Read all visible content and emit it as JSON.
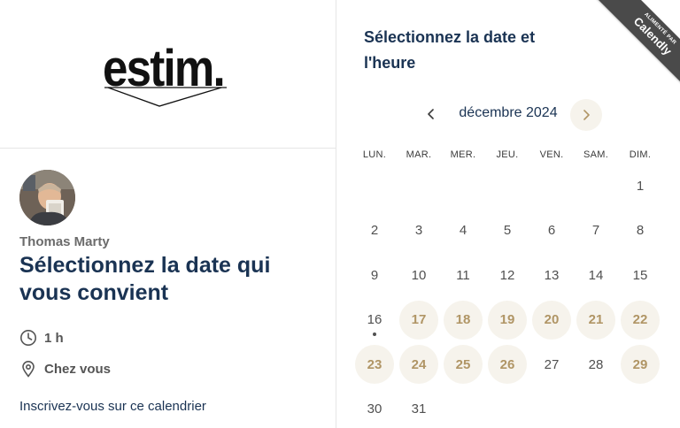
{
  "brand": {
    "logo_text": "estim."
  },
  "host": {
    "name": "Thomas Marty"
  },
  "event": {
    "title": "Sélectionnez la date qui vous convient",
    "duration": "1 h",
    "location": "Chez vous",
    "signup_link": "Inscrivez-vous sur ce calendrier"
  },
  "calendar": {
    "title": "Sélectionnez la date et l'heure",
    "month": "décembre 2024",
    "weekdays": [
      "LUN.",
      "MAR.",
      "MER.",
      "JEU.",
      "VEN.",
      "SAM.",
      "DIM."
    ],
    "days": [
      {
        "label": "1",
        "available": false
      },
      {
        "label": "2",
        "available": false
      },
      {
        "label": "3",
        "available": false
      },
      {
        "label": "4",
        "available": false
      },
      {
        "label": "5",
        "available": false
      },
      {
        "label": "6",
        "available": false
      },
      {
        "label": "7",
        "available": false
      },
      {
        "label": "8",
        "available": false
      },
      {
        "label": "9",
        "available": false
      },
      {
        "label": "10",
        "available": false
      },
      {
        "label": "11",
        "available": false
      },
      {
        "label": "12",
        "available": false
      },
      {
        "label": "13",
        "available": false
      },
      {
        "label": "14",
        "available": false
      },
      {
        "label": "15",
        "available": false
      },
      {
        "label": "16",
        "available": false,
        "today": true
      },
      {
        "label": "17",
        "available": true
      },
      {
        "label": "18",
        "available": true
      },
      {
        "label": "19",
        "available": true
      },
      {
        "label": "20",
        "available": true
      },
      {
        "label": "21",
        "available": true
      },
      {
        "label": "22",
        "available": true
      },
      {
        "label": "23",
        "available": true
      },
      {
        "label": "24",
        "available": true
      },
      {
        "label": "25",
        "available": true
      },
      {
        "label": "26",
        "available": true
      },
      {
        "label": "27",
        "available": false
      },
      {
        "label": "28",
        "available": false
      },
      {
        "label": "29",
        "available": true
      },
      {
        "label": "30",
        "available": false
      },
      {
        "label": "31",
        "available": false
      }
    ],
    "first_weekday_index": 6
  },
  "badge": {
    "small": "ALIMENTÉ PAR",
    "big": "Calendly"
  },
  "colors": {
    "primary_text": "#1a3353",
    "available_bg": "#f6f3ec",
    "available_text": "#b09565",
    "badge_bg": "#4a4a4a"
  },
  "icons": {
    "prev": "chevron-left-icon",
    "next": "chevron-right-icon",
    "duration": "clock-icon",
    "location": "map-pin-icon"
  }
}
